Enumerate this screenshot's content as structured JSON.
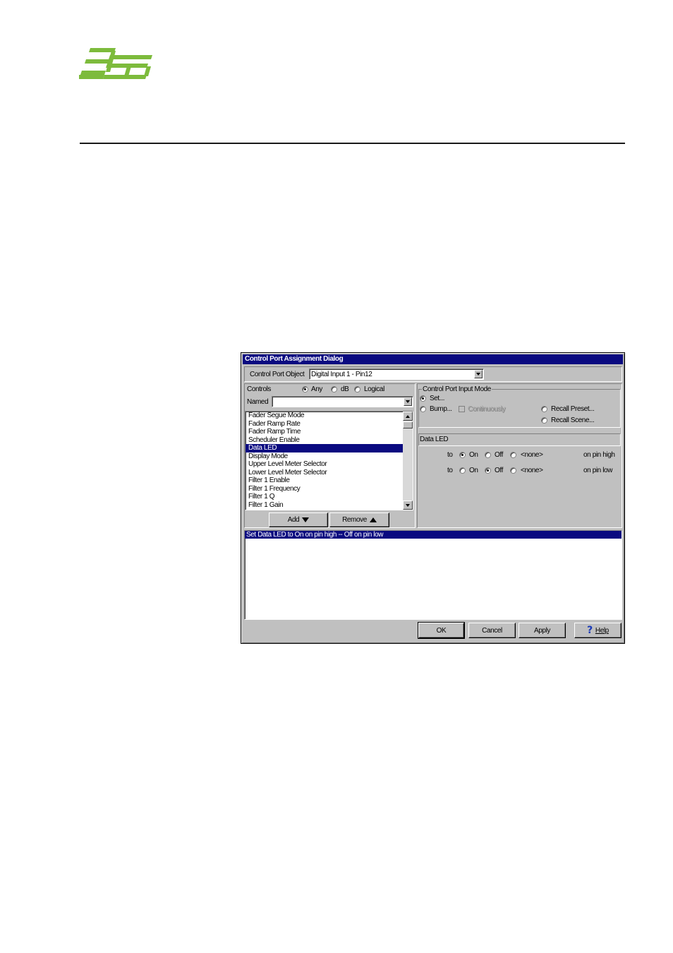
{
  "dialog": {
    "title": "Control Port Assignment Dialog",
    "control_port_object_label": "Control Port Object",
    "control_port_object_value": "Digital Input 1 - Pin12",
    "controls_label": "Controls",
    "filter_any": "Any",
    "filter_db": "dB",
    "filter_logical": "Logical",
    "filter_selected": "Any",
    "named_label": "Named",
    "named_value": "",
    "controls_list": [
      "Fader Segue Mode",
      "Fader Ramp Rate",
      "Fader Ramp Time",
      "Scheduler Enable",
      "Data LED",
      "Display Mode",
      "Upper Level Meter Selector",
      "Lower Level Meter Selector",
      "Filter 1 Enable",
      "Filter 1 Frequency",
      "Filter 1 Q",
      "Filter 1 Gain"
    ],
    "selected_control": "Data LED",
    "add_label": "Add",
    "remove_label": "Remove",
    "input_mode": {
      "title": "Control Port Input Mode",
      "set_label": "Set...",
      "bump_label": "Bump...",
      "continuously_label": "Continuously",
      "recall_preset_label": "Recall Preset...",
      "recall_scene_label": "Recall Scene...",
      "selected": "Set..."
    },
    "assignment_name": "Data LED",
    "pin_high": {
      "to_label": "to",
      "on": "On",
      "off": "Off",
      "none": "<none>",
      "suffix": "on pin high",
      "selected": "On"
    },
    "pin_low": {
      "to_label": "to",
      "on": "On",
      "off": "Off",
      "none": "<none>",
      "suffix": "on pin low",
      "selected": "Off"
    },
    "assignments": [
      "Set Data LED to On on pin high -- Off on pin low"
    ],
    "ok_label": "OK",
    "cancel_label": "Cancel",
    "apply_label": "Apply",
    "help_label": "Help"
  },
  "colors": {
    "logo_green": "#7dbb3c",
    "title_bar": "#0a0a80",
    "dialog_face": "#c0c0c0"
  }
}
